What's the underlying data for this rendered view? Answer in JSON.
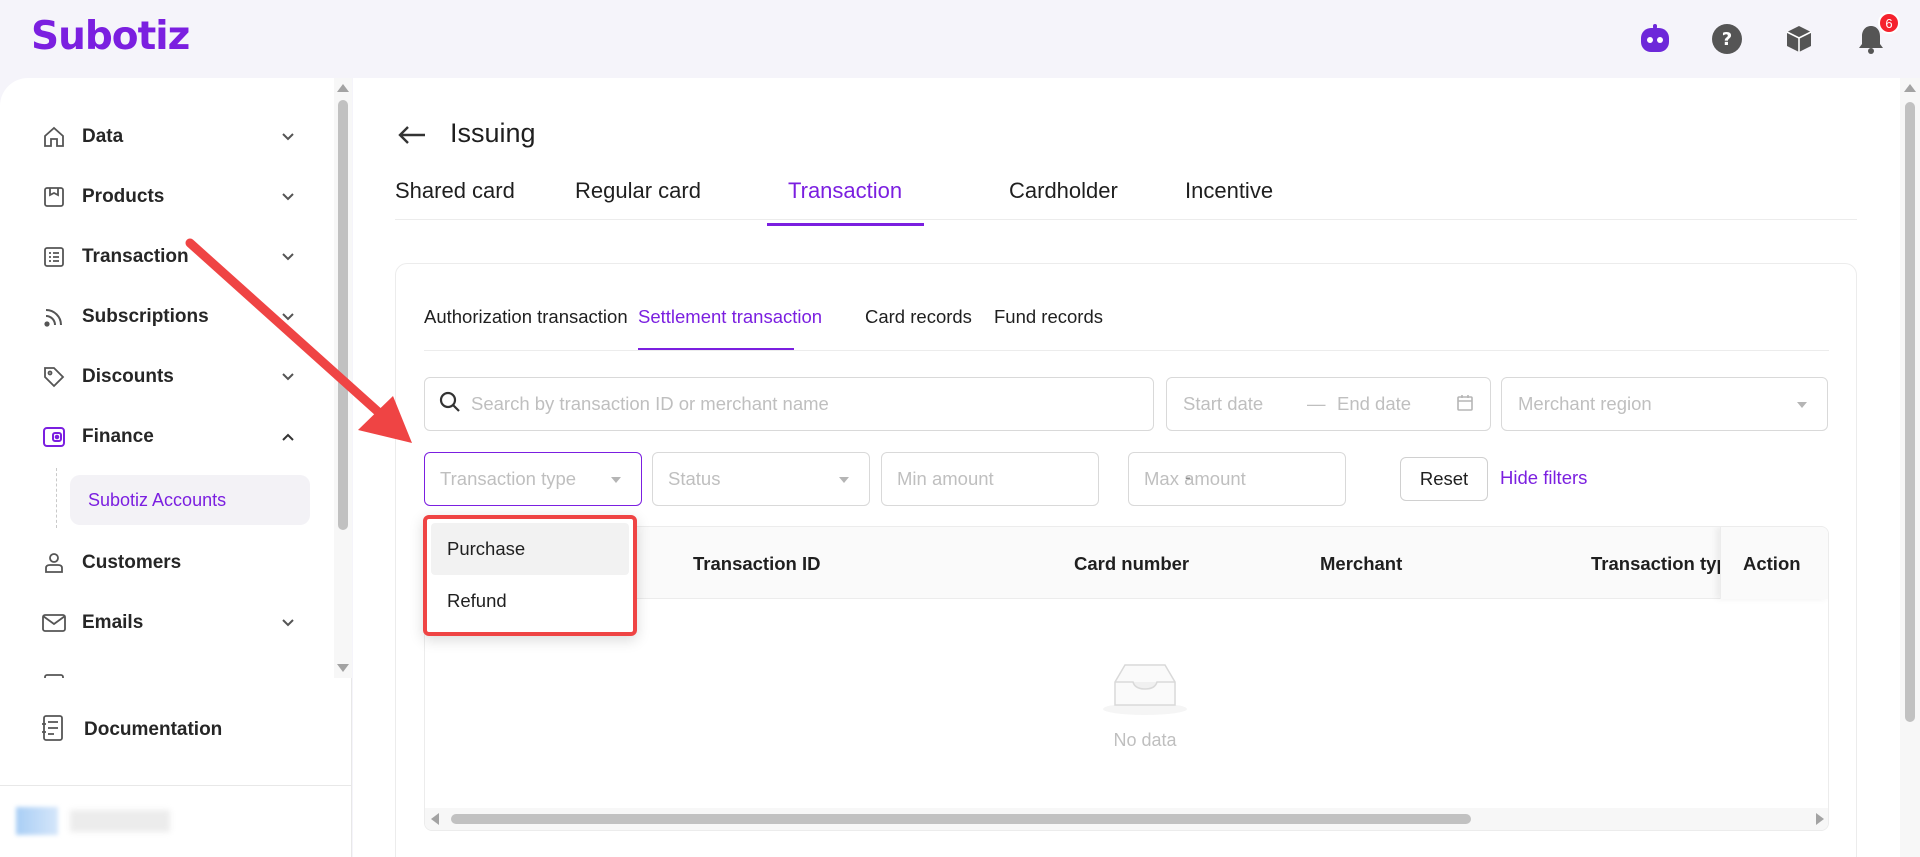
{
  "app": {
    "logo": "Subotiz",
    "notification_count": "6"
  },
  "topbar": {
    "icons": [
      "assistant-bot-icon",
      "help-icon",
      "package-icon",
      "bell-icon"
    ]
  },
  "sidebar": {
    "items": [
      {
        "label": "Data",
        "icon": "home-icon",
        "expanded": false
      },
      {
        "label": "Products",
        "icon": "box-icon",
        "expanded": false
      },
      {
        "label": "Transaction",
        "icon": "list-icon",
        "expanded": false
      },
      {
        "label": "Subscriptions",
        "icon": "rss-icon",
        "expanded": false
      },
      {
        "label": "Discounts",
        "icon": "tag-icon",
        "expanded": false
      },
      {
        "label": "Finance",
        "icon": "wallet-icon",
        "expanded": true
      },
      {
        "label": "Customers",
        "icon": "user-icon",
        "expanded": false
      },
      {
        "label": "Emails",
        "icon": "mail-icon",
        "expanded": false
      }
    ],
    "finance_subitem": "Subotiz Accounts",
    "documentation": "Documentation"
  },
  "page": {
    "title": "Issuing",
    "tabs": [
      "Shared card",
      "Regular card",
      "Transaction",
      "Cardholder",
      "Incentive"
    ],
    "active_tab": "Transaction",
    "subtabs": [
      "Authorization transaction",
      "Settlement transaction",
      "Card records",
      "Fund records"
    ],
    "active_subtab": "Settlement transaction"
  },
  "filters": {
    "search_placeholder": "Search by transaction ID or merchant name",
    "start_date_placeholder": "Start date",
    "date_separator": "—",
    "end_date_placeholder": "End date",
    "merchant_region_placeholder": "Merchant region",
    "transaction_type_placeholder": "Transaction type",
    "status_placeholder": "Status",
    "min_amount_placeholder": "Min amount",
    "amount_separator": "-",
    "max_amount_placeholder": "Max amount",
    "reset_label": "Reset",
    "hide_filters_label": "Hide filters"
  },
  "dropdown": {
    "options": [
      "Purchase",
      "Refund"
    ]
  },
  "table": {
    "columns": [
      "Transaction ID",
      "Card number",
      "Merchant",
      "Transaction typ",
      "Action"
    ],
    "empty_text": "No data"
  },
  "colors": {
    "accent": "#7b1fe0",
    "highlight_red": "#ef4444",
    "arrow_red": "#ef4444"
  }
}
